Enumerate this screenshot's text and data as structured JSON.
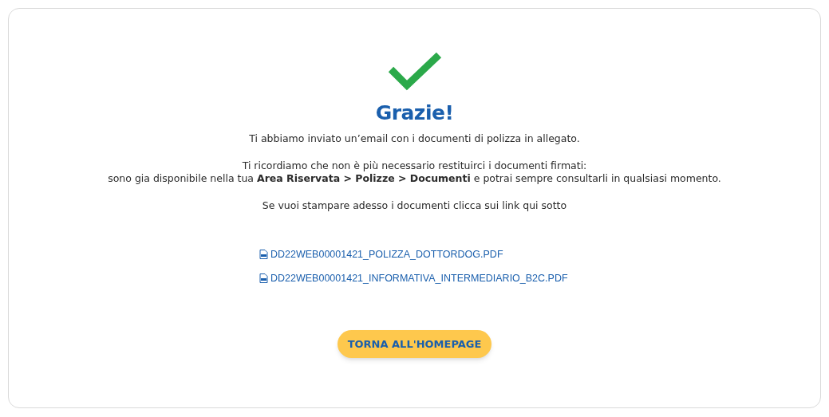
{
  "title": "Grazie!",
  "paragraphs": [
    "Ti abbiamo inviato un’email con i documenti di polizza in allegato.",
    "Ti ricordiamo che non è più necessario restituirci i documenti firmati:\nsono gia disponibile nella tua **Area Riservata > Polizze > Documenti** e potrai sempre consultarli in qualsiasi momento.",
    "Se vuoi stampare adesso i documenti clicca sui link qui sotto"
  ],
  "documents": [
    "DD22WEB00001421_POLIZZA_DOTTORDOG.PDF",
    "DD22WEB00001421_INFORMATIVA_INTERMEDIARIO_B2C.PDF"
  ],
  "button": "TORNA ALL'HOMEPAGE"
}
